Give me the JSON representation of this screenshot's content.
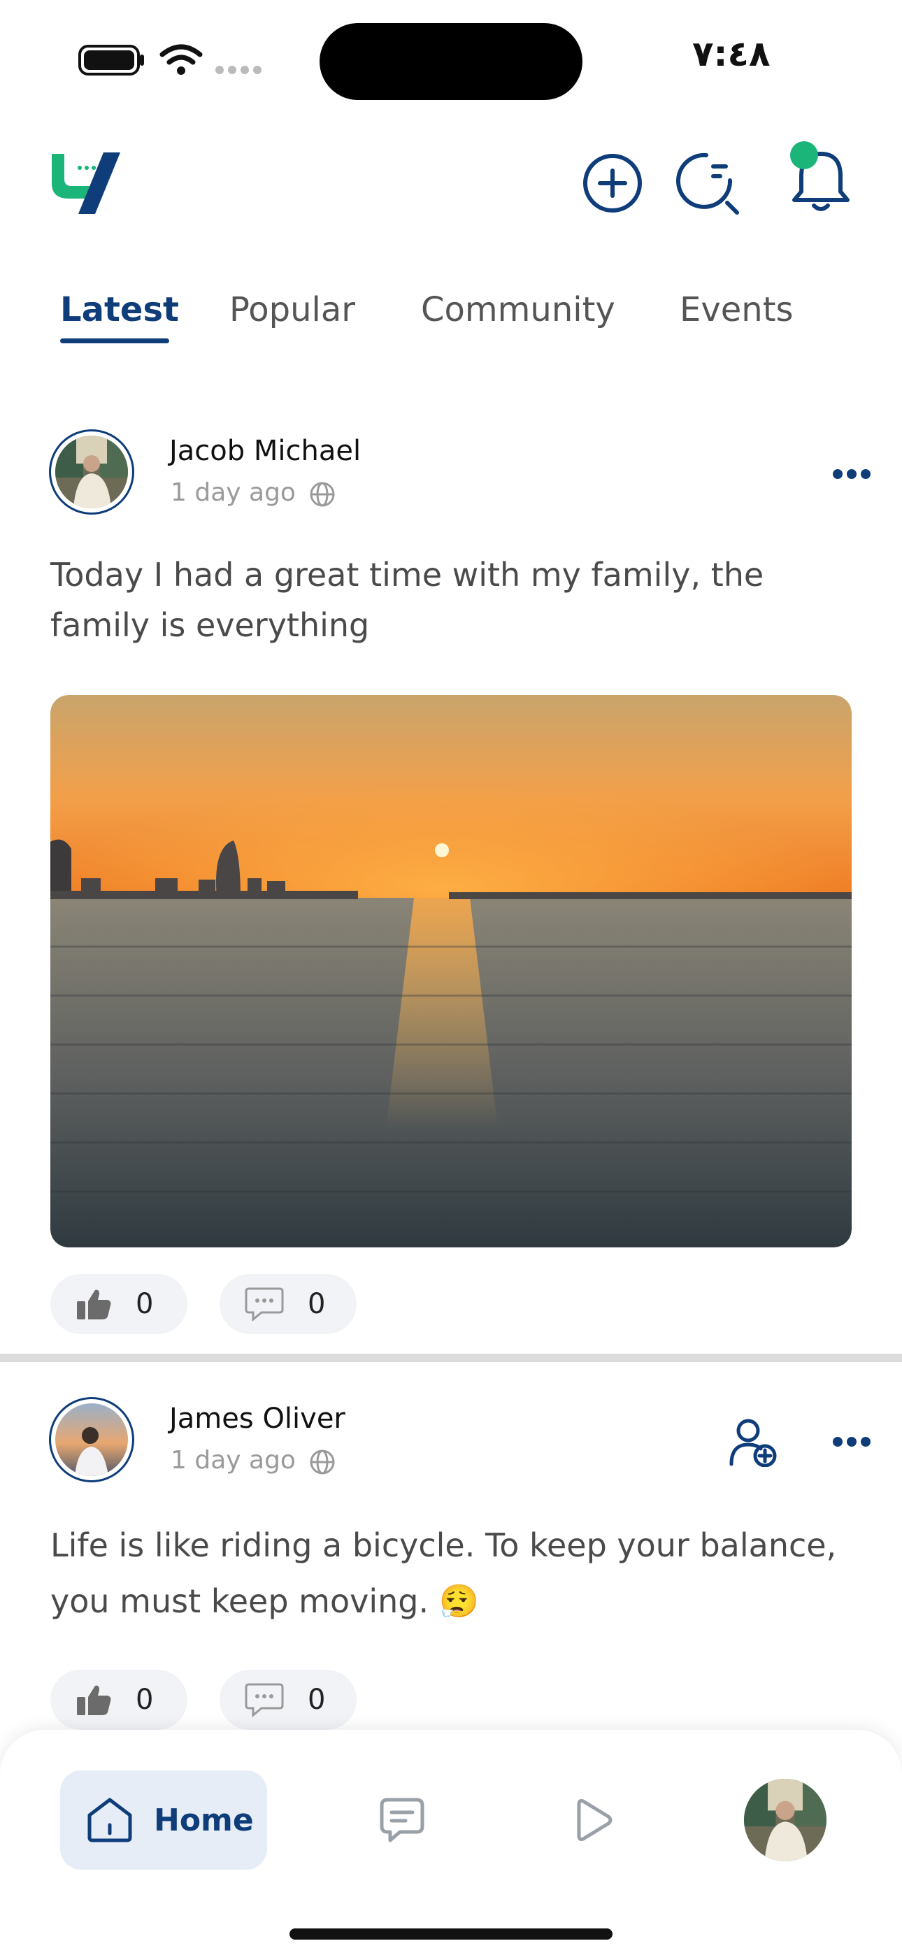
{
  "status_bar": {
    "time": "٧:٤٨"
  },
  "colors": {
    "primary": "#0f3d7a",
    "accent": "#1bb57a",
    "pill_bg": "#f1f3f6"
  },
  "tabs": [
    {
      "label": "Latest",
      "active": true
    },
    {
      "label": "Popular",
      "active": false
    },
    {
      "label": "Community",
      "active": false
    },
    {
      "label": "Events",
      "active": false
    }
  ],
  "posts": [
    {
      "author": "Jacob Michael",
      "time": "1 day ago",
      "text": "Today I had a great time with my family, the family is everything",
      "likes": "0",
      "comments": "0"
    },
    {
      "author": "James Oliver",
      "time": "1 day ago",
      "text": "Life is like riding a bicycle. To keep your balance, you must keep moving. 😮‍💨",
      "likes": "0",
      "comments": "0"
    }
  ],
  "nav": {
    "home_label": "Home"
  }
}
